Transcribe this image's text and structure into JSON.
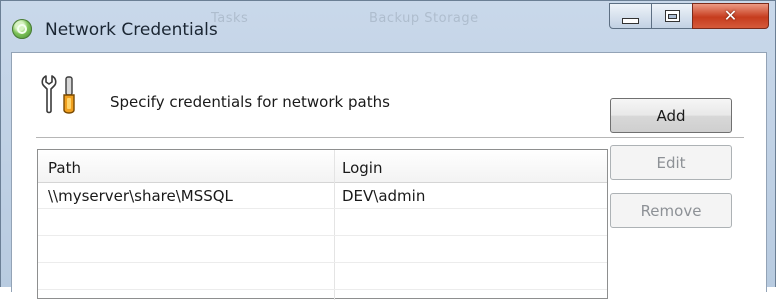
{
  "window": {
    "title": "Network Credentials",
    "background_tabs": [
      "Tasks",
      "Backup Storage"
    ],
    "controls": {
      "minimize": "minimize-icon",
      "maximize": "maximize-icon",
      "close_glyph": "✕"
    }
  },
  "header": {
    "icon": "tools-icon",
    "text": "Specify credentials for network paths"
  },
  "table": {
    "columns": [
      "Path",
      "Login"
    ],
    "rows": [
      {
        "path": "\\\\myserver\\share\\MSSQL",
        "login": "DEV\\admin"
      },
      {
        "path": "",
        "login": ""
      },
      {
        "path": "",
        "login": ""
      },
      {
        "path": "",
        "login": ""
      }
    ]
  },
  "buttons": {
    "add": "Add",
    "edit": "Edit",
    "remove": "Remove"
  },
  "colors": {
    "titlebar": "#c9d8ea",
    "close_button": "#c63c1e",
    "disabled_text": "#8d9196"
  }
}
